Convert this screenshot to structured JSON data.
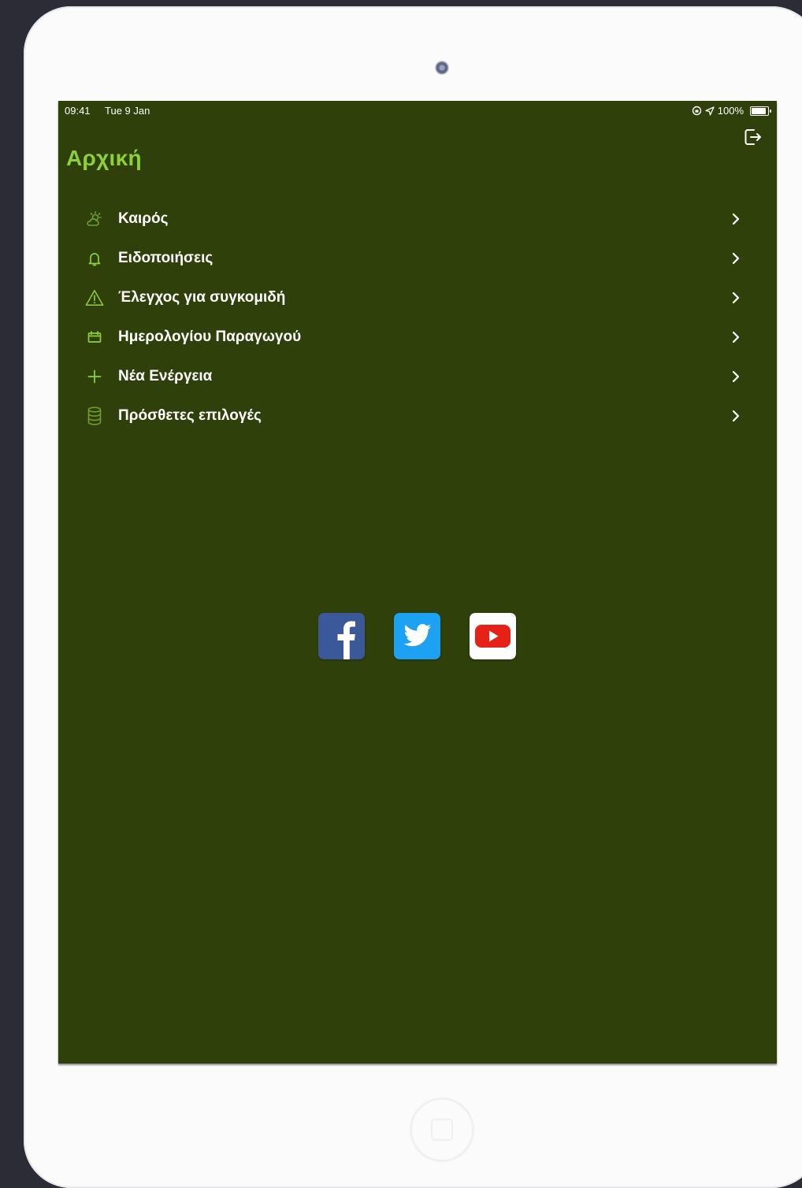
{
  "status_bar": {
    "time": "09:41",
    "date": "Tue 9 Jan",
    "battery_text": "100%",
    "battery_level": 1.0
  },
  "header": {
    "title": "Αρχική",
    "logout_icon": "logout-icon"
  },
  "menu": {
    "items": [
      {
        "label": "Καιρός",
        "icon": "weather-icon"
      },
      {
        "label": "Ειδοποιήσεις",
        "icon": "bell-icon"
      },
      {
        "label": "Έλεγχος για συγκομιδή",
        "icon": "warning-icon"
      },
      {
        "label": "Ημερολογίου Παραγωγού",
        "icon": "calendar-icon"
      },
      {
        "label": "Νέα Ενέργεια",
        "icon": "plus-icon"
      },
      {
        "label": "Πρόσθετες επιλογές",
        "icon": "database-icon"
      }
    ]
  },
  "social": [
    {
      "name": "facebook",
      "icon": "facebook-icon"
    },
    {
      "name": "twitter",
      "icon": "twitter-icon"
    },
    {
      "name": "youtube",
      "icon": "youtube-icon"
    }
  ],
  "colors": {
    "screen_background": "#2f400b",
    "accent": "#8cd13a",
    "text": "#ffffff",
    "facebook": "#3b5998",
    "twitter": "#1da1f2",
    "youtube": "#e62117"
  }
}
